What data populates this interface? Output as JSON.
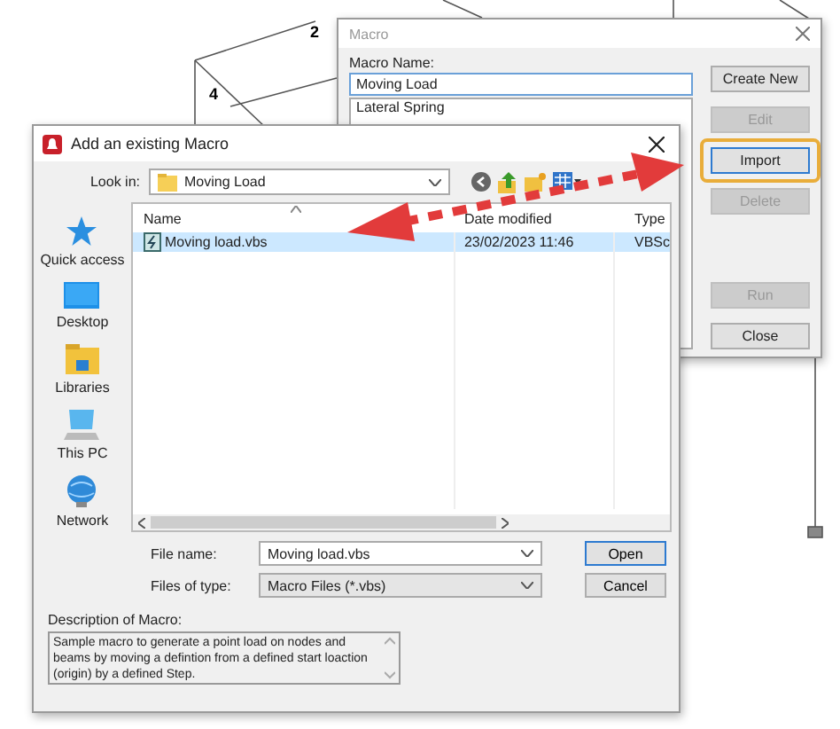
{
  "background_drawing": {
    "node_labels": [
      "2",
      "4"
    ]
  },
  "macro_dialog": {
    "title": "Macro",
    "name_label": "Macro Name:",
    "name_value": "Moving Load",
    "macro_list": [
      "Lateral Spring"
    ],
    "top_buttons": [
      {
        "label": "Create New",
        "disabled": false,
        "highlighted": false
      },
      {
        "label": "Edit",
        "disabled": true,
        "highlighted": false
      },
      {
        "label": "Import",
        "disabled": false,
        "highlighted": true
      },
      {
        "label": "Delete",
        "disabled": true,
        "highlighted": false
      }
    ],
    "bottom_buttons": [
      {
        "label": "Run",
        "disabled": true,
        "highlighted": false
      },
      {
        "label": "Close",
        "disabled": false,
        "highlighted": false
      }
    ]
  },
  "import_dialog": {
    "title": "Add an existing Macro",
    "look_in_label": "Look in:",
    "look_in_value": "Moving Load",
    "places": [
      {
        "kind": "star",
        "label": "Quick access"
      },
      {
        "kind": "desktop",
        "label": "Desktop"
      },
      {
        "kind": "libraries",
        "label": "Libraries"
      },
      {
        "kind": "pc",
        "label": "This PC"
      },
      {
        "kind": "network",
        "label": "Network"
      }
    ],
    "columns": [
      "Name",
      "Date modified",
      "Type"
    ],
    "files": [
      {
        "name": "Moving load.vbs",
        "date": "23/02/2023 11:46",
        "type": "VBSc",
        "selected": true
      }
    ],
    "file_name_label": "File name:",
    "file_name_value": "Moving load.vbs",
    "file_type_label": "Files of type:",
    "file_type_value": "Macro Files (*.vbs)",
    "action_buttons": [
      {
        "label": "Open",
        "default": true
      },
      {
        "label": "Cancel",
        "default": false
      }
    ],
    "description_label": "Description of Macro:",
    "description": "Sample macro to generate a point load on nodes and beams by moving a defintion from a defined start loaction (origin) by a defined Step."
  }
}
